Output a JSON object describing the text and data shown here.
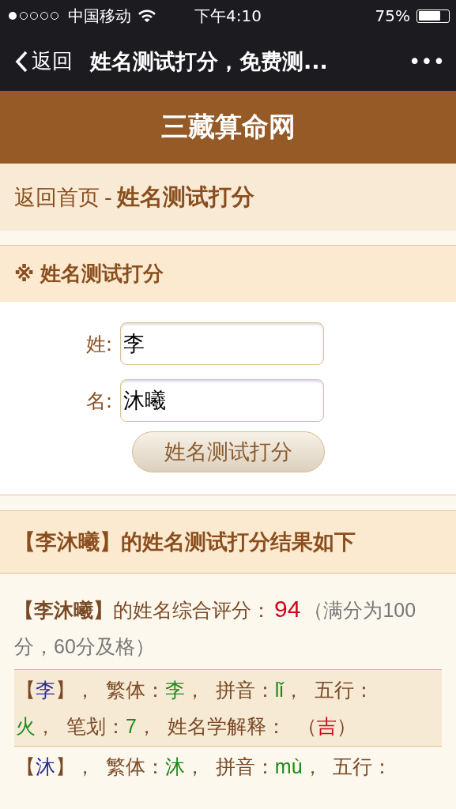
{
  "status_bar": {
    "carrier": "中国移动",
    "time": "下午4:10",
    "battery": "75%"
  },
  "nav_bar": {
    "back": "返回",
    "title": "姓名测试打分，免费测...",
    "more": "•••"
  },
  "site_header": {
    "title": "三藏算命网"
  },
  "breadcrumb": {
    "home": "返回首页",
    "separator": "-",
    "current": "姓名测试打分"
  },
  "form_section": {
    "title_mark": "※",
    "title": "姓名测试打分",
    "fields": [
      {
        "label": "姓:",
        "value": "李"
      },
      {
        "label": "名:",
        "value": "沐曦"
      }
    ],
    "submit": "姓名测试打分"
  },
  "result_section": {
    "title": "【李沐曦】的姓名测试打分结果如下",
    "score": {
      "name": "【李沐曦】",
      "label": "的姓名综合评分：",
      "value": "94",
      "note": "（满分为100分，60分及格）"
    },
    "chars": [
      {
        "selected": true,
        "lines": [
          [
            {
              "kind": "plain",
              "text": "【"
            },
            {
              "kind": "char",
              "text": "李"
            },
            {
              "kind": "plain",
              "text": "】，  繁体："
            },
            {
              "kind": "value",
              "text": "李"
            },
            {
              "kind": "plain",
              "text": "，  拼音："
            },
            {
              "kind": "value",
              "text": "lǐ"
            },
            {
              "kind": "plain",
              "text": "，  五行："
            }
          ],
          [
            {
              "kind": "value",
              "text": "火"
            },
            {
              "kind": "plain",
              "text": "，  笔划："
            },
            {
              "kind": "value",
              "text": "7"
            },
            {
              "kind": "plain",
              "text": "，  姓名学解释：  （"
            },
            {
              "kind": "verdict",
              "text": "吉"
            },
            {
              "kind": "plain",
              "text": "）"
            }
          ]
        ]
      },
      {
        "selected": false,
        "lines": [
          [
            {
              "kind": "plain",
              "text": "【"
            },
            {
              "kind": "char",
              "text": "沐"
            },
            {
              "kind": "plain",
              "text": "】，  繁体："
            },
            {
              "kind": "value",
              "text": "沐"
            },
            {
              "kind": "plain",
              "text": "，  拼音："
            },
            {
              "kind": "value",
              "text": "mù"
            },
            {
              "kind": "plain",
              "text": "，  五行："
            }
          ]
        ]
      }
    ]
  }
}
